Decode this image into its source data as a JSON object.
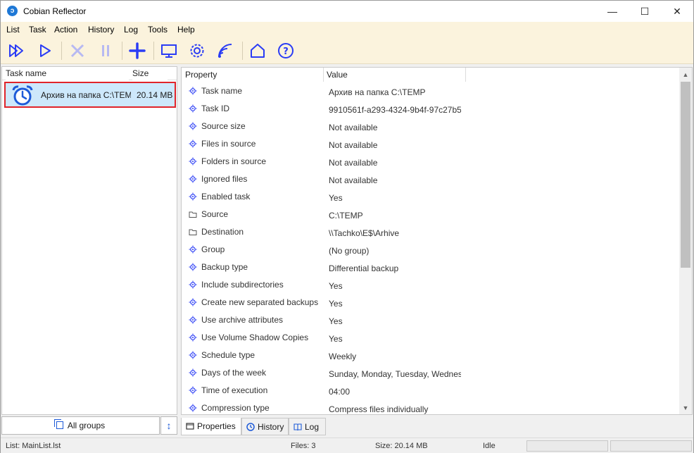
{
  "window": {
    "title": "Cobian Reflector",
    "app_icon_glyph": "ↄ",
    "minimize": "—",
    "maximize": "☐",
    "close": "✕"
  },
  "menu": [
    "List",
    "Task",
    "Action",
    "History",
    "Log",
    "Tools",
    "Help"
  ],
  "toolbar": [
    {
      "name": "run-all-icon",
      "enabled": true
    },
    {
      "name": "run-icon",
      "enabled": true
    },
    {
      "name": "stop-icon",
      "enabled": false
    },
    {
      "name": "pause-icon",
      "enabled": false
    },
    {
      "name": "add-task-icon",
      "enabled": true
    },
    {
      "name": "monitor-icon",
      "enabled": true
    },
    {
      "name": "gear-icon",
      "enabled": true
    },
    {
      "name": "signal-icon",
      "enabled": true
    },
    {
      "name": "home-icon",
      "enabled": true
    },
    {
      "name": "help-icon",
      "enabled": true
    }
  ],
  "tasklist": {
    "headers": {
      "name": "Task name",
      "size": "Size"
    },
    "items": [
      {
        "name": "Архив на папка C:\\TEMP",
        "size": "20.14 MB",
        "selected": true
      }
    ]
  },
  "groups": {
    "label": "All groups",
    "sort_glyph": "↕"
  },
  "properties": {
    "headers": {
      "property": "Property",
      "value": "Value"
    },
    "rows": [
      {
        "icon": "property-icon",
        "name": "Task name",
        "value": "Архив на папка C:\\TEMP"
      },
      {
        "icon": "property-icon",
        "name": "Task ID",
        "value": "9910561f-a293-4324-9b4f-97c27b5"
      },
      {
        "icon": "property-icon",
        "name": "Source size",
        "value": "Not available"
      },
      {
        "icon": "property-icon",
        "name": "Files in source",
        "value": "Not available"
      },
      {
        "icon": "property-icon",
        "name": "Folders in source",
        "value": "Not available"
      },
      {
        "icon": "property-icon",
        "name": "Ignored files",
        "value": "Not available"
      },
      {
        "icon": "property-icon",
        "name": "Enabled task",
        "value": "Yes"
      },
      {
        "icon": "folder-icon",
        "name": "Source",
        "value": "C:\\TEMP"
      },
      {
        "icon": "folder-icon",
        "name": "Destination",
        "value": "\\\\Tachko\\E$\\Arhive"
      },
      {
        "icon": "property-icon",
        "name": "Group",
        "value": "(No group)"
      },
      {
        "icon": "property-icon",
        "name": "Backup type",
        "value": "Differential backup"
      },
      {
        "icon": "property-icon",
        "name": "Include subdirectories",
        "value": "Yes"
      },
      {
        "icon": "property-icon",
        "name": "Create new separated backups",
        "value": "Yes"
      },
      {
        "icon": "property-icon",
        "name": "Use archive attributes",
        "value": "Yes"
      },
      {
        "icon": "property-icon",
        "name": "Use Volume Shadow Copies",
        "value": "Yes"
      },
      {
        "icon": "property-icon",
        "name": "Schedule type",
        "value": "Weekly"
      },
      {
        "icon": "property-icon",
        "name": "Days of the week",
        "value": "Sunday, Monday, Tuesday, Wednesday"
      },
      {
        "icon": "property-icon",
        "name": "Time of execution",
        "value": "04:00"
      },
      {
        "icon": "property-icon",
        "name": "Compression type",
        "value": "Compress files individually"
      }
    ],
    "scroll_fraction_visible": 0.55
  },
  "tabs": [
    {
      "label": "Properties",
      "icon": "properties-tab-icon",
      "active": true
    },
    {
      "label": "History",
      "icon": "history-tab-icon",
      "active": false
    },
    {
      "label": "Log",
      "icon": "log-tab-icon",
      "active": false
    }
  ],
  "status": {
    "list": "List: MainList.lst",
    "files": "Files: 3",
    "size": "Size: 20.14 MB",
    "state": "Idle"
  },
  "colors": {
    "accent": "#2a3cf5",
    "disabled": "#b7b9f2",
    "selection": "#cde8fb",
    "highlight_border": "#e0242a",
    "toolbar_bg": "#fbf3dd"
  }
}
